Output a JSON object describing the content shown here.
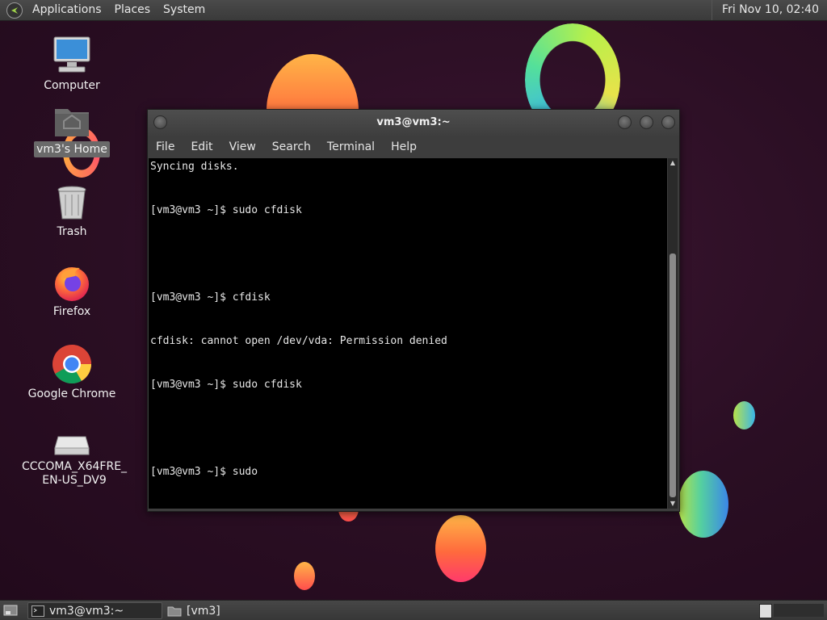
{
  "top_panel": {
    "menus": [
      "Applications",
      "Places",
      "System"
    ],
    "clock": "Fri Nov 10, 02:40"
  },
  "desktop_icons": [
    {
      "id": "computer",
      "label": "Computer",
      "icon": "computer-icon"
    },
    {
      "id": "home",
      "label": "vm3's Home",
      "icon": "home-folder-icon",
      "selected": true
    },
    {
      "id": "trash",
      "label": "Trash",
      "icon": "trash-icon"
    },
    {
      "id": "firefox",
      "label": "Firefox",
      "icon": "firefox-icon"
    },
    {
      "id": "chrome",
      "label": "Google Chrome",
      "icon": "chrome-icon"
    },
    {
      "id": "disc",
      "label_line1": "CCCOMA_X64FRE_",
      "label_line2": "EN-US_DV9",
      "icon": "optical-drive-icon"
    }
  ],
  "terminal": {
    "title": "vm3@vm3:~",
    "menu": [
      "File",
      "Edit",
      "View",
      "Search",
      "Terminal",
      "Help"
    ],
    "lines": [
      "Syncing disks.",
      "[vm3@vm3 ~]$ sudo cfdisk",
      "",
      "[vm3@vm3 ~]$ cfdisk",
      "cfdisk: cannot open /dev/vda: Permission denied",
      "[vm3@vm3 ~]$ sudo cfdisk",
      "",
      "[vm3@vm3 ~]$ sudo "
    ]
  },
  "taskbar": {
    "tasks": [
      {
        "label": "vm3@vm3:~",
        "icon": "terminal-icon",
        "active": true
      },
      {
        "label": "[vm3]",
        "icon": "folder-icon",
        "active": false
      }
    ]
  },
  "colors": {
    "panel": "#3f3f3f",
    "wallpaper": "#2a0f24",
    "terminal_bg": "#000000",
    "terminal_fg": "#e6e6e6"
  }
}
